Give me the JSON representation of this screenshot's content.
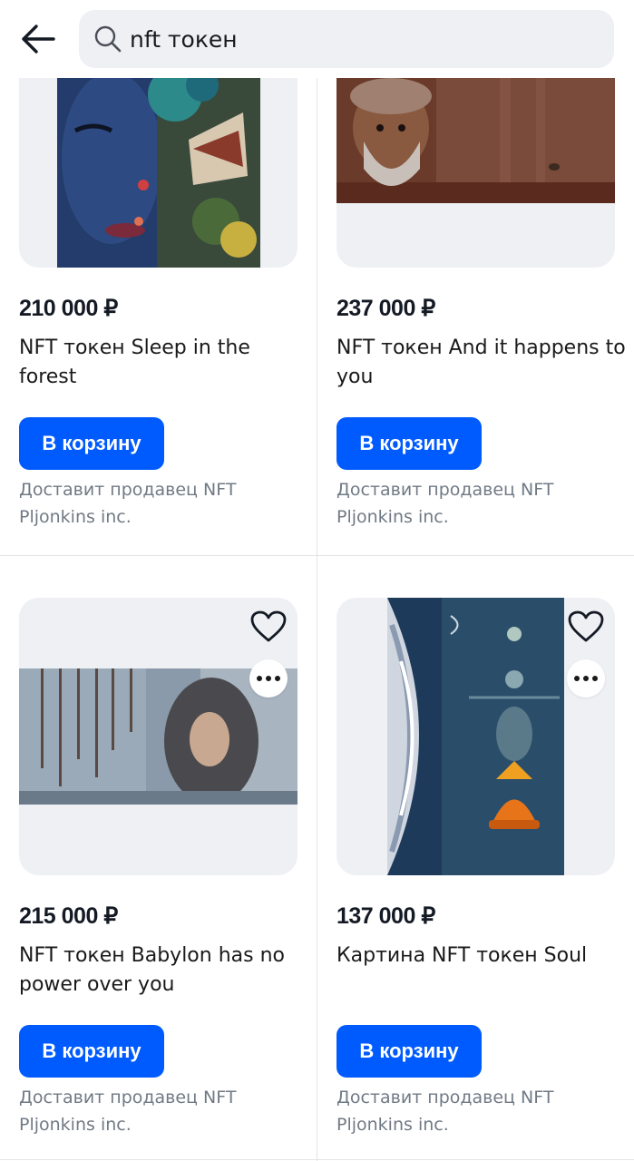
{
  "search": {
    "query": "nft токен"
  },
  "products": [
    {
      "price": "210 000 ₽",
      "title": "NFT токен Sleep in the forest",
      "cart_label": "В корзину",
      "seller": "Доставит продавец NFT Pljonkins inc."
    },
    {
      "price": "237 000 ₽",
      "title": "NFT токен And it happens to you",
      "cart_label": "В корзину",
      "seller": "Доставит продавец NFT Pljonkins inc."
    },
    {
      "price": "215 000 ₽",
      "title": "NFT токен Babylon has no power over you",
      "cart_label": "В корзину",
      "seller": "Доставит продавец NFT Pljonkins inc."
    },
    {
      "price": "137 000 ₽",
      "title": "Картина NFT токен Soul",
      "cart_label": "В корзину",
      "seller": "Доставит продавец NFT Pljonkins inc."
    }
  ],
  "icons": {
    "back": "arrow-left-icon",
    "search": "search-icon",
    "favorite": "heart-icon",
    "more": "more-dots-icon"
  },
  "colors": {
    "accent": "#005bff",
    "card_bg": "#eef0f4",
    "muted_text": "#707a85"
  }
}
